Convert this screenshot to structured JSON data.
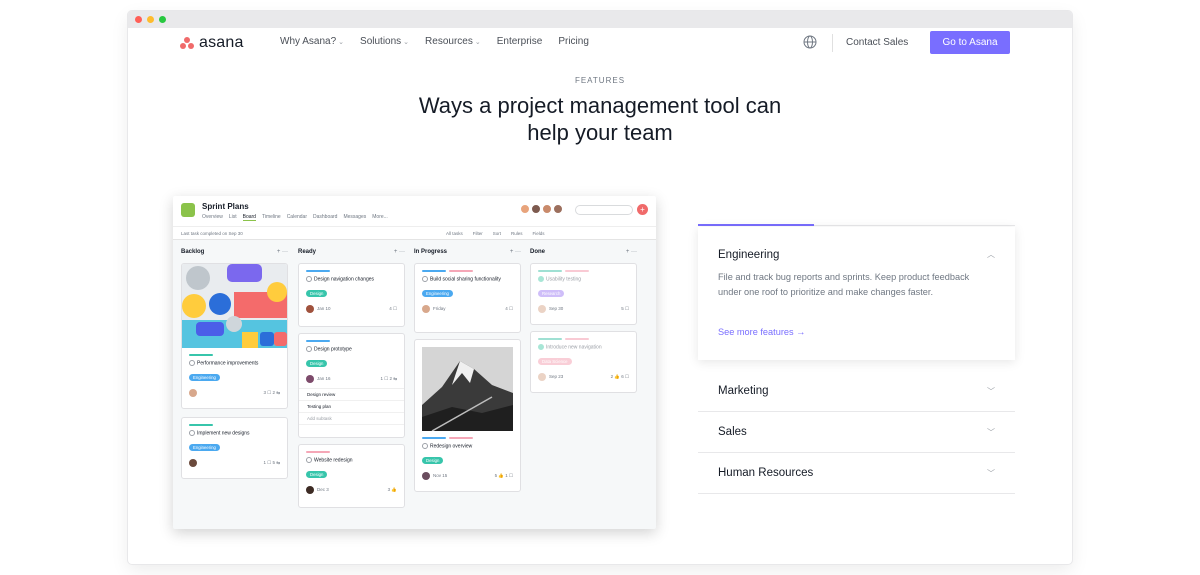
{
  "nav": {
    "logo": "asana",
    "links": [
      {
        "label": "Why Asana?",
        "dropdown": true
      },
      {
        "label": "Solutions",
        "dropdown": true
      },
      {
        "label": "Resources",
        "dropdown": true
      },
      {
        "label": "Enterprise",
        "dropdown": false
      },
      {
        "label": "Pricing",
        "dropdown": false
      }
    ],
    "contact": "Contact Sales",
    "cta": "Go to Asana"
  },
  "hero": {
    "eyebrow": "FEATURES",
    "headline_line1": "Ways a project management tool can",
    "headline_line2": "help your team"
  },
  "app": {
    "title": "Sprint Plans",
    "tabs": [
      "Overview",
      "List",
      "Board",
      "Timeline",
      "Calendar",
      "Dashboard",
      "Messages",
      "More..."
    ],
    "active_tab": "Board",
    "last_completed": "Last task completed on Sep 30",
    "toolbar": [
      "All tasks",
      "Filter",
      "Sort",
      "Rules",
      "Fields"
    ],
    "columns": [
      {
        "name": "Backlog"
      },
      {
        "name": "Ready"
      },
      {
        "name": "In Progress"
      },
      {
        "name": "Done"
      }
    ],
    "cards": {
      "backlog1": {
        "title": "Performance improvements",
        "tag": "Engineering",
        "meta": "3 ☐ 2 ⇆"
      },
      "backlog2": {
        "title": "Implement new designs",
        "tag": "Engineering",
        "meta": "1 ☐ 5 ⇆"
      },
      "ready1": {
        "title": "Design navigation changes",
        "tag": "Design",
        "date": "Jan 10",
        "meta": "4 ☐"
      },
      "ready2": {
        "title": "Design prototype",
        "tag": "Design",
        "date": "Jan 16",
        "meta": "1 ☐ 2 ⇆",
        "subtasks": [
          "Design review",
          "Testing plan",
          "Add subtask"
        ]
      },
      "ready3": {
        "title": "Website redesign",
        "tag": "Design",
        "date": "Dec 3",
        "meta": "3 👍"
      },
      "prog1": {
        "title": "Build social sharing functionality",
        "tag": "Engineering",
        "date": "Friday",
        "meta": "4 ☐"
      },
      "prog2": {
        "title": "Redesign overview",
        "tag": "Design",
        "date": "Nov 15",
        "meta": "5 👍 1 ☐"
      },
      "done1": {
        "title": "Usability testing",
        "tag": "Research",
        "date": "Sep 30",
        "meta": "5 ☐"
      },
      "done2": {
        "title": "Introduce new navigation",
        "tag": "Data Science",
        "date": "Sep 23",
        "meta": "2 👍 6 ☐"
      }
    }
  },
  "accordion": {
    "open": {
      "heading": "Engineering",
      "description": "File and track bug reports and sprints. Keep product feedback under one roof to prioritize and make changes faster.",
      "link": "See more features →"
    },
    "items": [
      "Marketing",
      "Sales",
      "Human Resources"
    ]
  },
  "colors": {
    "accent": "#796eff",
    "coral": "#f06a6a",
    "engineering": "#4ba9f0",
    "design": "#37c5ab",
    "research": "#a889f5",
    "data_science": "#f5a7b7"
  }
}
